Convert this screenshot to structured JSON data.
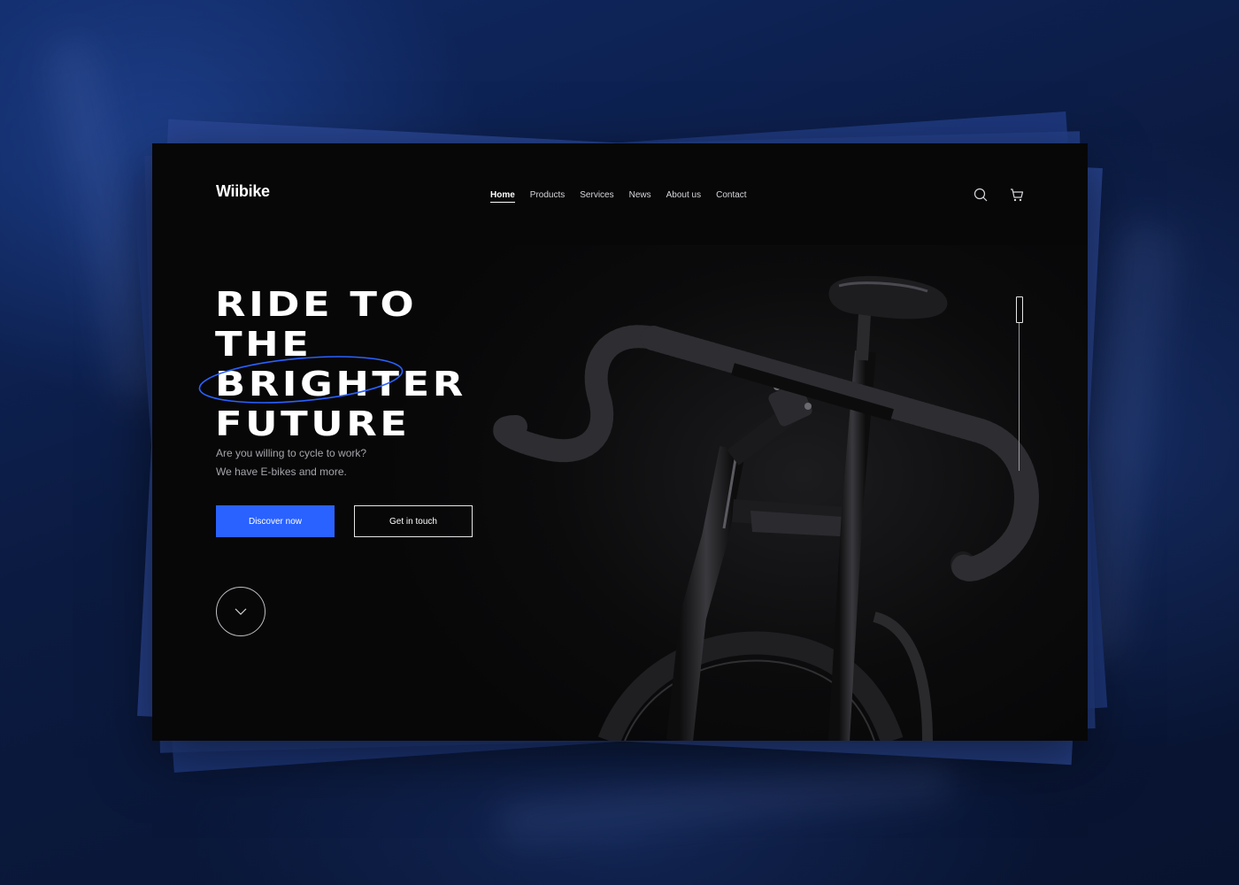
{
  "brand": {
    "name": "Wiibike"
  },
  "nav": {
    "items": [
      {
        "label": "Home",
        "active": true
      },
      {
        "label": "Products",
        "active": false
      },
      {
        "label": "Services",
        "active": false
      },
      {
        "label": "News",
        "active": false
      },
      {
        "label": "About us",
        "active": false
      },
      {
        "label": "Contact",
        "active": false
      }
    ]
  },
  "header_icons": {
    "search": "search-icon",
    "cart": "cart-icon"
  },
  "hero": {
    "headline": [
      "RIDE TO",
      "THE",
      "BRIGHTER",
      "FUTURE"
    ],
    "highlighted_word": "BRIGHTER",
    "subtext": [
      "Are you willing to cycle to work?",
      "We have E-bikes and more."
    ],
    "primary_button": "Discover now",
    "secondary_button": "Get in touch",
    "scroll_icon": "chevron-down-icon"
  },
  "colors": {
    "accent": "#2a62ff",
    "page_background": "#070708",
    "backdrop": "#0b1a40",
    "text": "#ffffff",
    "muted_text": "#a5a5ab"
  },
  "slider": {
    "position": 0
  }
}
